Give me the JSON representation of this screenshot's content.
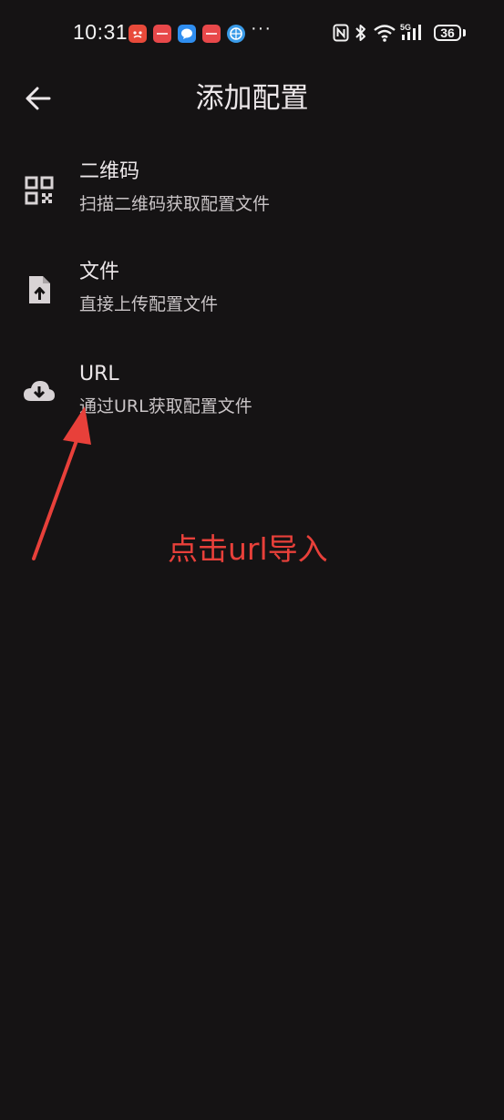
{
  "status_bar": {
    "time": "10:31",
    "more": "···",
    "battery_level": "36",
    "icons": [
      "nfc-icon",
      "bluetooth-icon",
      "wifi-icon",
      "5g-signal-icon",
      "battery-icon"
    ],
    "notification_colors": [
      "#e84a3a",
      "#e8484a",
      "#2f8ef0",
      "#e8484a",
      "#3a9be8"
    ]
  },
  "app_bar": {
    "title": "添加配置",
    "back_icon": "arrow-left-icon"
  },
  "options": [
    {
      "title": "二维码",
      "subtitle": "扫描二维码获取配置文件",
      "icon": "qr-code-icon"
    },
    {
      "title": "文件",
      "subtitle": "直接上传配置文件",
      "icon": "file-upload-icon"
    },
    {
      "title": "URL",
      "subtitle": "通过URL获取配置文件",
      "icon": "cloud-download-icon"
    }
  ],
  "annotation": {
    "text": "点击url导入",
    "color": "#e8403a"
  },
  "colors": {
    "background": "#151314",
    "primary_text": "#ece7e9",
    "secondary_text": "#c9c4c6",
    "icon": "#d8d3d5"
  }
}
